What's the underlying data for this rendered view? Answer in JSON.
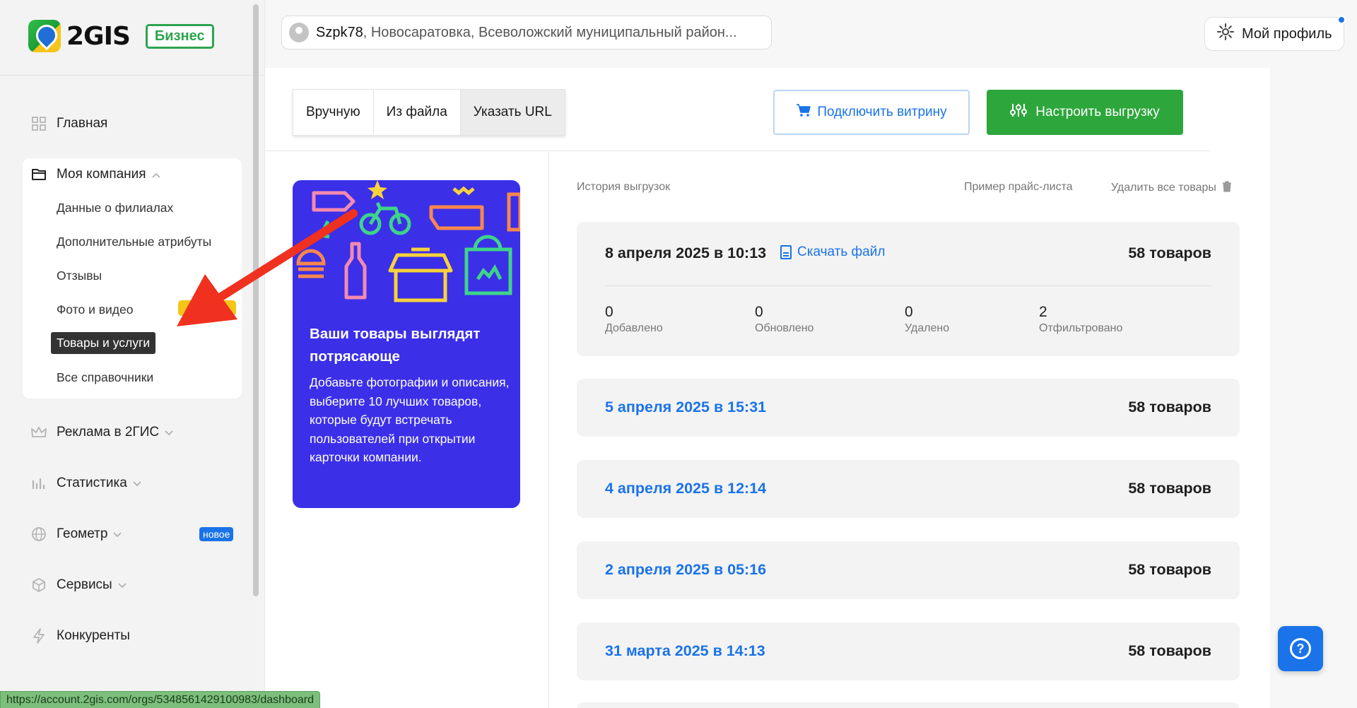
{
  "brand": {
    "logo_text": "2GIS",
    "badge": "Бизнес"
  },
  "sidebar": {
    "items": [
      {
        "label": "Главная",
        "icon": "grid-icon"
      },
      {
        "label": "Моя компания",
        "icon": "folder-icon"
      },
      {
        "label": "Реклама в 2ГИС",
        "icon": "crown-icon"
      },
      {
        "label": "Статистика",
        "icon": "bar-chart-icon"
      },
      {
        "label": "Геометр",
        "icon": "globe-icon",
        "badge": "новое"
      },
      {
        "label": "Сервисы",
        "icon": "cube-icon"
      },
      {
        "label": "Конкуренты",
        "icon": "lightning-icon"
      }
    ],
    "company_sub": [
      {
        "label": "Данные о филиалах"
      },
      {
        "label": "Дополнительные атрибуты"
      },
      {
        "label": "Отзывы"
      },
      {
        "label": "Фото и видео"
      },
      {
        "label": "Товары и услуги",
        "active": true
      },
      {
        "label": "Все справочники"
      }
    ]
  },
  "header": {
    "address_name": "Szpk78",
    "address_rest": ", Новосаратовка, Всеволожский муниципальный район...",
    "profile_label": "Мой профиль"
  },
  "tabs": [
    {
      "label": "Вручную"
    },
    {
      "label": "Из файла"
    },
    {
      "label": "Указать URL",
      "active": true
    }
  ],
  "actions": {
    "connect_showcase": "Подключить витрину",
    "configure_export": "Настроить выгрузку"
  },
  "promo": {
    "title": "Ваши товары выглядят потрясающе",
    "text": "Добавьте фотографии и описания, выберите 10 лучших товаров, которые будут встречать пользователей при открытии карточки компании."
  },
  "history": {
    "title": "История выгрузок",
    "sample_link": "Пример прайс-листа",
    "delete_all": "Удалить все товары",
    "entries": [
      {
        "date": "8 апреля 2025 в 10:13",
        "count": "58 товаров",
        "download": "Скачать файл",
        "stats": [
          {
            "value": "0",
            "label": "Добавлено"
          },
          {
            "value": "0",
            "label": "Обновлено"
          },
          {
            "value": "0",
            "label": "Удалено"
          },
          {
            "value": "2",
            "label": "Отфильтровано"
          }
        ]
      },
      {
        "date": "5 апреля 2025 в 15:31",
        "count": "58 товаров"
      },
      {
        "date": "4 апреля 2025 в 12:14",
        "count": "58 товаров"
      },
      {
        "date": "2 апреля 2025 в 05:16",
        "count": "58 товаров"
      },
      {
        "date": "31 марта 2025 в 14:13",
        "count": "58 товаров"
      }
    ]
  },
  "status_bar_url": "https://account.2gis.com/orgs/5348561429100983/dashboard",
  "colors": {
    "accent": "#1a73e8",
    "green": "#2da63b",
    "promo_bg": "#3b2fe8",
    "annotation_arrow": "#f0311f"
  }
}
